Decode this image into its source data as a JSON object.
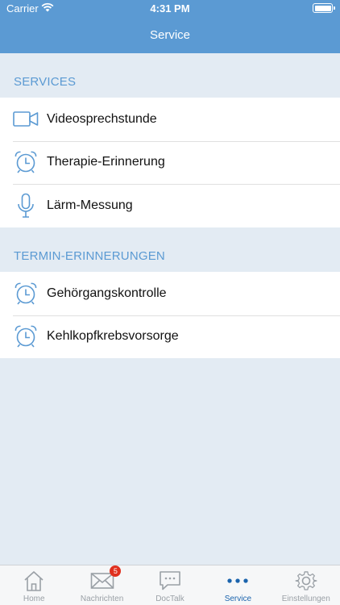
{
  "status_bar": {
    "carrier": "Carrier",
    "time": "4:31 PM"
  },
  "nav": {
    "title": "Service"
  },
  "sections": [
    {
      "header": "SERVICES",
      "items": [
        {
          "label": "Videosprechstunde",
          "icon": "video-camera-icon"
        },
        {
          "label": "Therapie-Erinnerung",
          "icon": "alarm-clock-icon"
        },
        {
          "label": "Lärm-Messung",
          "icon": "microphone-icon"
        }
      ]
    },
    {
      "header": "TERMIN-ERINNERUNGEN",
      "items": [
        {
          "label": "Gehörgangskontrolle",
          "icon": "alarm-clock-icon"
        },
        {
          "label": "Kehlkopfkrebsvorsorge",
          "icon": "alarm-clock-icon"
        }
      ]
    }
  ],
  "tabbar": {
    "tabs": [
      {
        "label": "Home",
        "icon": "house-icon",
        "active": false
      },
      {
        "label": "Nachrichten",
        "icon": "envelope-icon",
        "badge": "5",
        "active": false
      },
      {
        "label": "DocTalk",
        "icon": "chat-bubble-icon",
        "active": false
      },
      {
        "label": "Service",
        "icon": "more-dots-icon",
        "active": true
      },
      {
        "label": "Einstellungen",
        "icon": "gear-icon",
        "active": false
      }
    ]
  },
  "colors": {
    "nav_background": "#5b9ad3",
    "page_background": "#e3ebf3",
    "section_header": "#5b9ad3",
    "icon": "#5b9ad3",
    "tab_active": "#1b64ad",
    "tab_inactive": "#9aa0a6",
    "badge": "#e0301e"
  }
}
